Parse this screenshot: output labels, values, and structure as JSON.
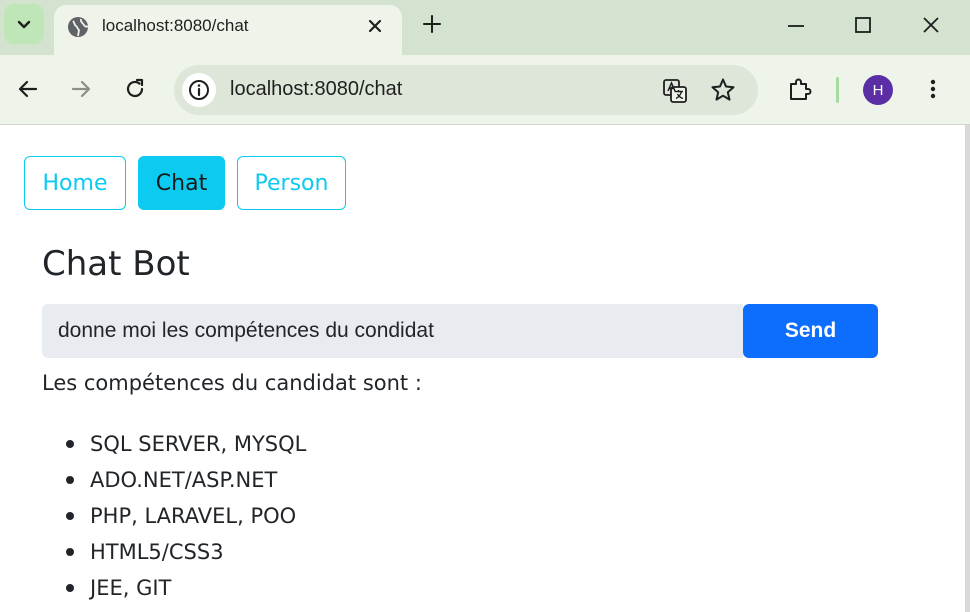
{
  "browser": {
    "tab_title": "localhost:8080/chat",
    "url": "localhost:8080/chat",
    "profile_initial": "H",
    "icons": [
      "tab-search-icon",
      "globe-icon",
      "close-icon",
      "plus-icon",
      "minimize-icon",
      "maximize-icon",
      "window-close-icon",
      "back-icon",
      "forward-icon",
      "reload-icon",
      "site-info-icon",
      "translate-icon",
      "star-icon",
      "extensions-icon",
      "menu-icon"
    ]
  },
  "nav": {
    "items": [
      {
        "label": "Home",
        "active": false
      },
      {
        "label": "Chat",
        "active": true
      },
      {
        "label": "Person",
        "active": false
      }
    ]
  },
  "chat": {
    "title": "Chat Bot",
    "input_value": "donne moi les compétences du condidat",
    "send_label": "Send",
    "response_intro": "Les compétences du candidat sont :",
    "skills": [
      "SQL SERVER, MYSQL",
      "ADO.NET/ASP.NET",
      "PHP, LARAVEL, POO",
      "HTML5/CSS3",
      "JEE, GIT"
    ]
  },
  "colors": {
    "nav_accent": "#0dcaf0",
    "send_button": "#0d6efd",
    "chrome_tabbar": "#d3e3cf",
    "chrome_toolbar": "#eef4ea",
    "avatar": "#5b2ea6"
  }
}
